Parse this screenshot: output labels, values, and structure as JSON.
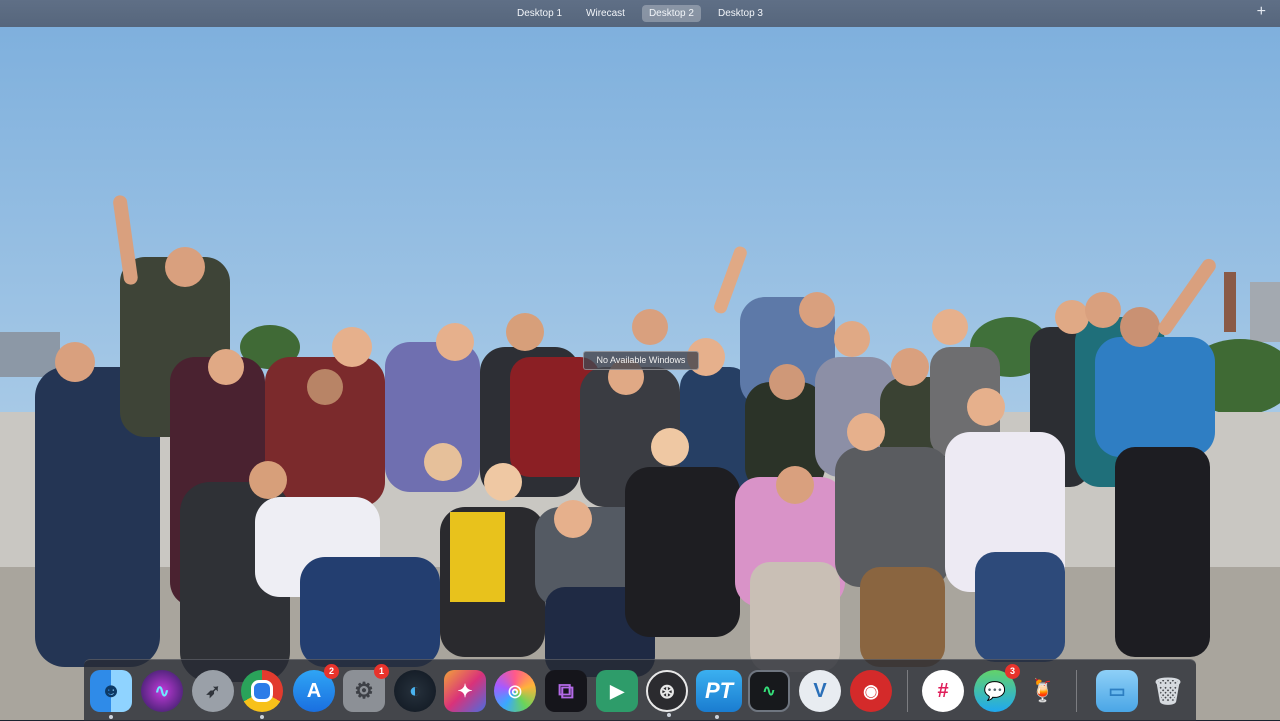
{
  "spaces_bar": {
    "spaces": [
      {
        "label": "Desktop 1",
        "active": false
      },
      {
        "label": "Wirecast",
        "active": false
      },
      {
        "label": "Desktop 2",
        "active": true
      },
      {
        "label": "Desktop 3",
        "active": false
      }
    ],
    "add_icon": "plus-icon",
    "add_glyph": "+"
  },
  "desktop": {
    "window_placeholder": "No Available Windows",
    "wallpaper": "group-photo-rooftop"
  },
  "dock": {
    "apps": [
      {
        "icon": "finder-icon",
        "badge": ""
      },
      {
        "icon": "siri-icon",
        "badge": ""
      },
      {
        "icon": "launchpad-icon",
        "badge": ""
      },
      {
        "icon": "chrome-icon",
        "badge": ""
      },
      {
        "icon": "app-store-icon",
        "badge": "2"
      },
      {
        "icon": "system-preferences-icon",
        "badge": "1"
      },
      {
        "icon": "app-icon",
        "badge": ""
      },
      {
        "icon": "final-cut-pro-icon",
        "badge": ""
      },
      {
        "icon": "motion-icon",
        "badge": ""
      },
      {
        "icon": "app-icon",
        "badge": ""
      },
      {
        "icon": "app-icon",
        "badge": ""
      },
      {
        "icon": "obs-icon",
        "badge": ""
      },
      {
        "icon": "pt-icon",
        "badge": ""
      },
      {
        "icon": "activity-monitor-icon",
        "badge": ""
      },
      {
        "icon": "v-app-icon",
        "badge": ""
      },
      {
        "icon": "app-icon",
        "badge": ""
      },
      {
        "icon": "slack-icon",
        "badge": ""
      },
      {
        "icon": "messages-icon",
        "badge": "3"
      },
      {
        "icon": "app-icon",
        "badge": ""
      },
      {
        "icon": "downloads-folder-icon",
        "badge": ""
      },
      {
        "icon": "trash-icon",
        "badge": ""
      }
    ]
  }
}
